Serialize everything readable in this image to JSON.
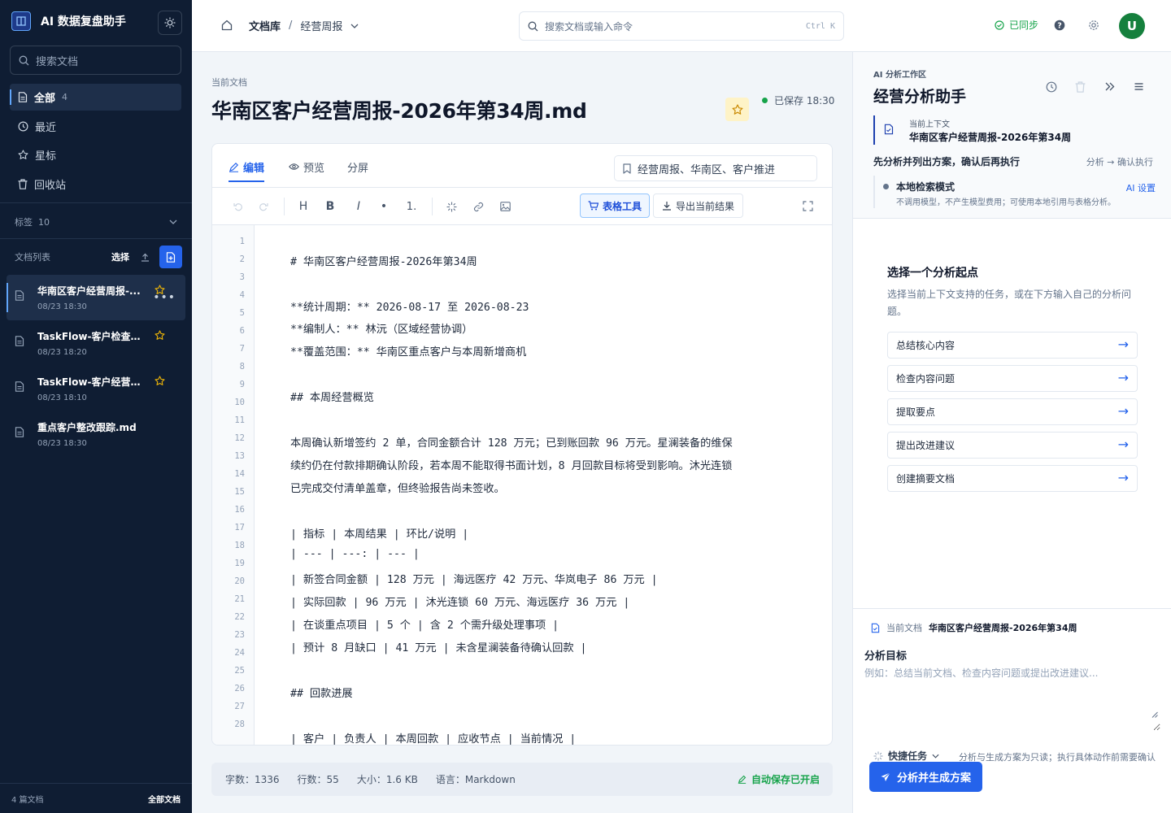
{
  "app": {
    "title": "AI 数据复盘助手"
  },
  "sidebar": {
    "search_placeholder": "搜索文档",
    "nav": [
      {
        "label": "全部",
        "count": "4",
        "icon": "file-icon",
        "active": true
      },
      {
        "label": "最近",
        "icon": "clock-icon"
      },
      {
        "label": "星标",
        "icon": "star-icon"
      },
      {
        "label": "回收站",
        "icon": "trash-icon"
      }
    ],
    "tags_label": "标签",
    "tags_count": "10",
    "doclist_label": "文档列表",
    "select_label": "选择",
    "docs": [
      {
        "title": "华南区客户经营周报-...",
        "date": "08/23 18:30",
        "starred": true,
        "active": true
      },
      {
        "title": "TaskFlow-客户检查...",
        "date": "08/23 18:20",
        "starred": true
      },
      {
        "title": "TaskFlow-客户经营...",
        "date": "08/23 18:10",
        "starred": true
      },
      {
        "title": "重点客户整改跟踪.md",
        "date": "08/23 18:30",
        "starred": false
      }
    ],
    "footer_count": "4 篇文档",
    "footer_all": "全部文档"
  },
  "topbar": {
    "breadcrumb_root": "文档库",
    "breadcrumb_sep": "/",
    "breadcrumb_current": "经营周报",
    "search_placeholder": "搜索文档或输入命令",
    "search_shortcut": "Ctrl K",
    "sync_status": "已同步",
    "avatar_initial": "U"
  },
  "document": {
    "current_label": "当前文档",
    "title": "华南区客户经营周报-2026年第34周.md",
    "saved": "已保存 18:30"
  },
  "editor": {
    "tabs": [
      {
        "label": "编辑",
        "icon": "pen-icon",
        "active": true
      },
      {
        "label": "预览",
        "icon": "eye-icon"
      },
      {
        "label": "分屏"
      }
    ],
    "tags_value": "经营周报、华南区、客户推进",
    "toolbar": {
      "heading": "H",
      "bold": "B",
      "italic": "I",
      "bullet": "•",
      "ordered": "1.",
      "table_tool": "表格工具",
      "export": "导出当前结果"
    },
    "lines": [
      "# 华南区客户经营周报-2026年第34周",
      "",
      "**统计周期：** 2026-08-17 至 2026-08-23",
      "**编制人：** 林沅（区域经营协调）",
      "**覆盖范围：** 华南区重点客户与本周新增商机",
      "",
      "## 本周经营概览",
      "",
      "本周确认新增签约 2 单，合同金额合计 128 万元；已到账回款 96 万元。星澜装备的维保",
      "续约仍在付款排期确认阶段，若本周不能取得书面计划，8 月回款目标将受到影响。沐光连锁",
      "已完成交付清单盖章，但终验报告尚未签收。",
      "",
      "| 指标 | 本周结果 | 环比/说明 |",
      "| --- | ---: | --- |",
      "| 新签合同金额 | 128 万元 | 海远医疗 42 万元、华岚电子 86 万元 |",
      "| 实际回款 | 96 万元 | 沐光连锁 60 万元、海远医疗 36 万元 |",
      "| 在谈重点项目 | 5 个 | 含 2 个需升级处理事项 |",
      "| 预计 8 月缺口 | 41 万元 | 未含星澜装备待确认回款 |",
      "",
      "## 回款进展",
      "",
      "| 客户 | 负责人 | 本周回款 | 应收节点 | 当前情况 |"
    ],
    "line_numbers": [
      "1",
      "2",
      "3",
      "4",
      "5",
      "6",
      "7",
      "8",
      "9",
      "10",
      "11",
      "12",
      "13",
      "14",
      "15",
      "16",
      "17",
      "18",
      "19",
      "20",
      "21",
      "22",
      "23",
      "24",
      "25",
      "26",
      "27",
      "28"
    ]
  },
  "status": {
    "chars": "字数：1336",
    "lines": "行数：55",
    "size": "大小：1.6 KB",
    "lang": "语言：Markdown",
    "autosave": "自动保存已开启"
  },
  "panel": {
    "label": "AI 分析工作区",
    "title": "经营分析助手",
    "ctx_label": "当前上下文",
    "ctx_value": "华南区客户经营周报-2026年第34周",
    "plan_note": "先分析并列出方案，确认后再执行",
    "plan_flow": "分析 → 确认执行",
    "mode_name": "本地检索模式",
    "mode_desc": "不调用模型，不产生模型费用；可使用本地引用与表格分析。",
    "mode_settings": "AI 设置",
    "start_title": "选择一个分析起点",
    "start_desc": "选择当前上下文支持的任务，或在下方输入自己的分析问题。",
    "tasks": [
      "总结核心内容",
      "检查内容问题",
      "提取要点",
      "提出改进建议",
      "创建摘要文档"
    ],
    "task_arrow": "→",
    "cur_doc_label": "当前文档",
    "cur_doc_value": "华南区客户经营周报-2026年第34周",
    "goal_label": "分析目标",
    "goal_placeholder": "例如：总结当前文档、检查内容问题或提出改进建议...",
    "quick_label": "快捷任务",
    "quick_note": "分析与生成方案为只读；执行具体动作前需要确认",
    "run_label": "分析并生成方案"
  },
  "colors": {
    "accent": "#2563eb",
    "sidebar_bg": "#0f1d33",
    "success": "#16a34a",
    "star": "#eab308"
  }
}
